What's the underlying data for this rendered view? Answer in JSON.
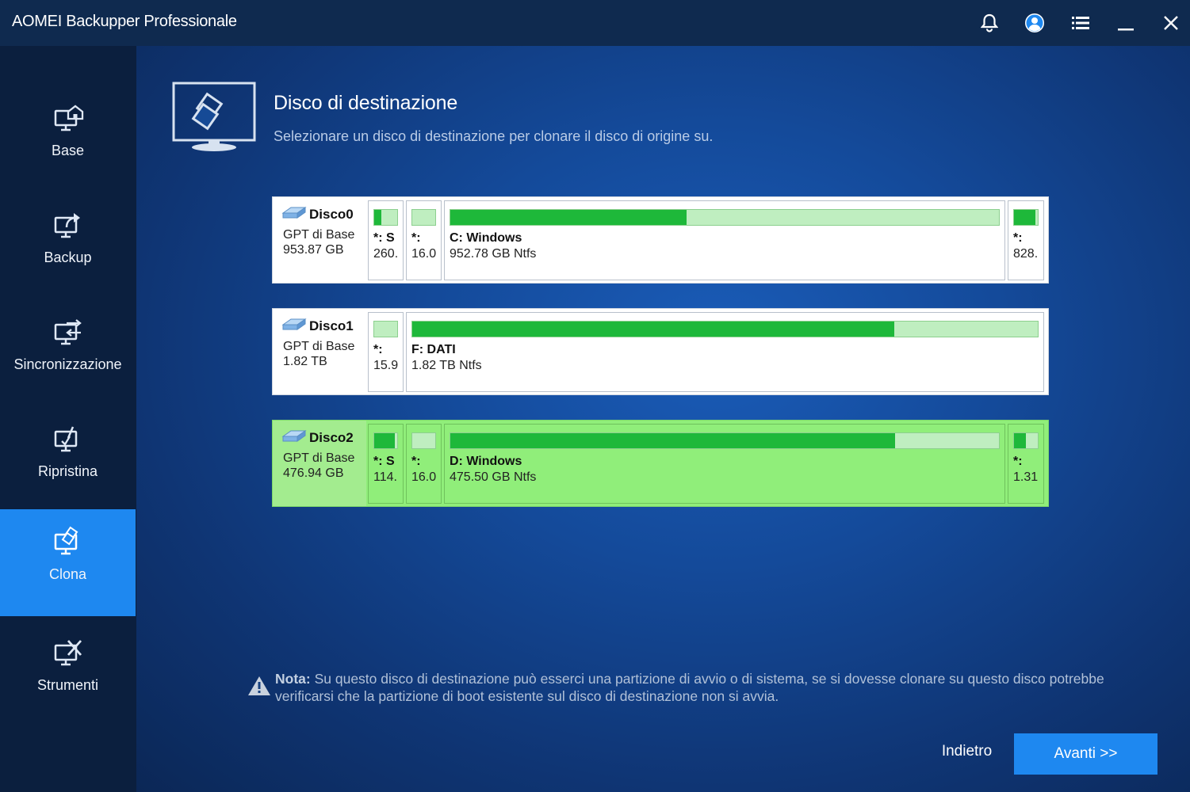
{
  "app": {
    "title": "AOMEI Backupper Professionale"
  },
  "titlebar": {
    "icons": [
      "bell-icon",
      "user-icon",
      "menu-icon",
      "minimize-icon",
      "close-icon"
    ]
  },
  "sidebar": {
    "items": [
      {
        "label": "Base",
        "icon": "home-monitor-icon"
      },
      {
        "label": "Backup",
        "icon": "backup-monitor-icon"
      },
      {
        "label": "Sincronizzazione",
        "icon": "sync-monitor-icon"
      },
      {
        "label": "Ripristina",
        "icon": "restore-monitor-icon"
      },
      {
        "label": "Clona",
        "icon": "clone-monitor-icon",
        "active": true
      },
      {
        "label": "Strumenti",
        "icon": "tools-monitor-icon"
      }
    ]
  },
  "main": {
    "title": "Disco di destinazione",
    "subtitle": "Selezionare un disco di destinazione per clonare il disco di origine su."
  },
  "disks": [
    {
      "name": "Disco0",
      "type": "GPT di Base",
      "size": "953.87 GB",
      "selected": false,
      "partitions": [
        {
          "label": "*: S",
          "size": "260.",
          "fill": 0.3
        },
        {
          "label": "*:",
          "size": "16.0",
          "fill": 0
        },
        {
          "label": "C: Windows",
          "size": "952.78 GB Ntfs",
          "fill": 0.43
        },
        {
          "label": "*:",
          "size": "828.",
          "fill": 0.9
        }
      ]
    },
    {
      "name": "Disco1",
      "type": "GPT di Base",
      "size": "1.82 TB",
      "selected": false,
      "partitions": [
        {
          "label": "*:",
          "size": "15.9",
          "fill": 0
        },
        {
          "label": "F: DATI",
          "size": "1.82 TB Ntfs",
          "fill": 0.77
        }
      ]
    },
    {
      "name": "Disco2",
      "type": "GPT di Base",
      "size": "476.94 GB",
      "selected": true,
      "partitions": [
        {
          "label": "*: S",
          "size": "114.",
          "fill": 0.9
        },
        {
          "label": "*:",
          "size": "16.0",
          "fill": 0
        },
        {
          "label": "D: Windows",
          "size": "475.50 GB Ntfs",
          "fill": 0.81
        },
        {
          "label": "*:",
          "size": "1.31",
          "fill": 0.5
        }
      ]
    }
  ],
  "note": {
    "prefix": "Nota:",
    "text": " Su questo disco di destinazione può esserci una partizione di avvio o di sistema, se si dovesse clonare su questo disco potrebbe verificarsi che la partizione di boot esistente sul disco di destinazione non si avvia."
  },
  "buttons": {
    "back": "Indietro",
    "next": "Avanti >>"
  },
  "colors": {
    "accent": "#1e88f0",
    "selected_row": "#90ee7a",
    "bar_fill": "#1eb83a",
    "bar_empty": "#bfeec0"
  }
}
